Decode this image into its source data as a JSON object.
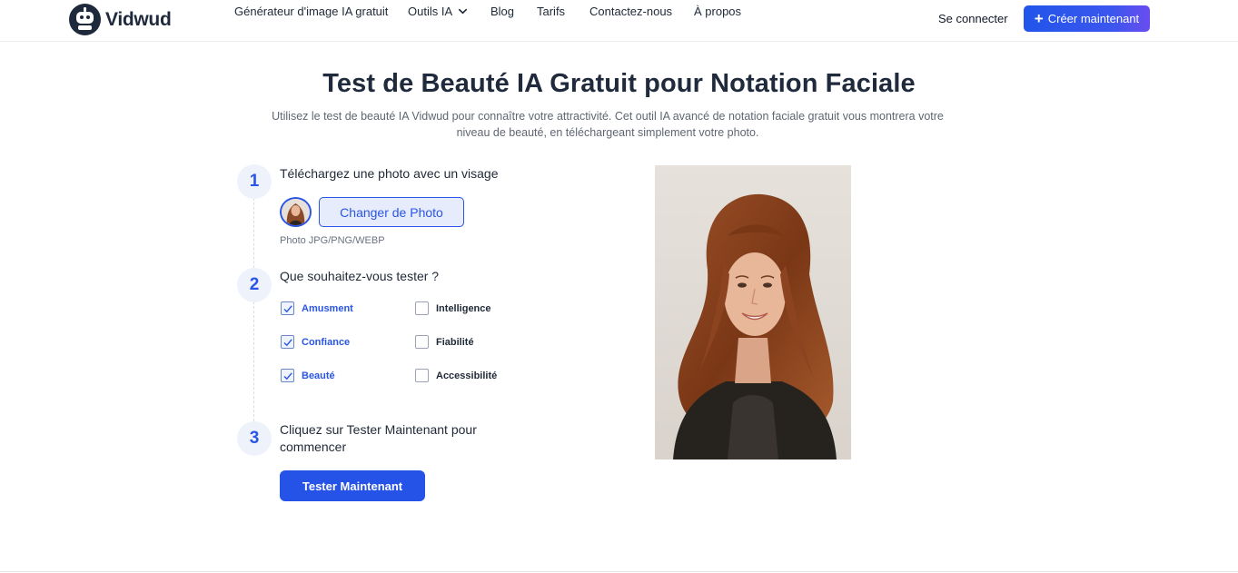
{
  "brand": {
    "name": "Vidwud"
  },
  "nav": {
    "items": [
      {
        "label": "Générateur d'image IA gratuit"
      },
      {
        "label": "Outils IA"
      },
      {
        "label": "Blog"
      },
      {
        "label": "Tarifs"
      },
      {
        "label": "Contactez-nous"
      },
      {
        "label": "À propos"
      }
    ],
    "signin_label": "Se connecter",
    "cta_label": "Créer maintenant"
  },
  "hero": {
    "title": "Test de Beauté IA Gratuit pour Notation Faciale",
    "subtitle": "Utilisez le test de beauté IA Vidwud pour connaître votre attractivité. Cet outil IA avancé de notation faciale gratuit vous montrera votre niveau de beauté, en téléchargeant simplement votre photo."
  },
  "steps": [
    {
      "number": "1",
      "title": "Téléchargez une photo avec un visage",
      "button_label": "Changer de Photo",
      "formats": "Photo JPG/PNG/WEBP"
    },
    {
      "number": "2",
      "title": "Que souhaitez-vous tester ?",
      "options": [
        {
          "label": "Amusment",
          "checked": true
        },
        {
          "label": "Intelligence",
          "checked": false
        },
        {
          "label": "Confiance",
          "checked": true
        },
        {
          "label": "Fiabilité",
          "checked": false
        },
        {
          "label": "Beauté",
          "checked": true
        },
        {
          "label": "Accessibilité",
          "checked": false
        }
      ]
    },
    {
      "number": "3",
      "title": "Cliquez sur Tester Maintenant pour commencer",
      "button_label": "Tester Maintenant"
    }
  ],
  "colors": {
    "accent": "#2552e7",
    "title": "#1f2a3d",
    "step_bg": "#eef2fb"
  },
  "icons": {
    "logo": "robot-logo-icon",
    "dropdown": "chevron-down-icon",
    "cta": "plus-icon",
    "checkbox": "check-icon"
  }
}
